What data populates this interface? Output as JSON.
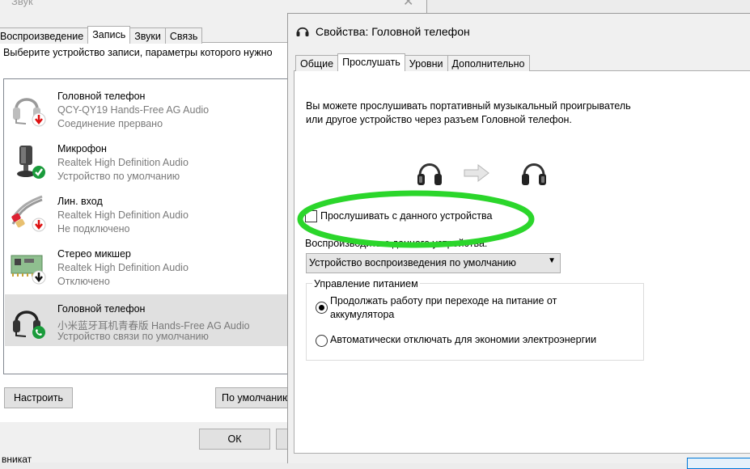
{
  "sound_window": {
    "title": "Звук",
    "close_glyph": "✕",
    "tabs": [
      {
        "label": "Воспроизведение"
      },
      {
        "label": "Запись"
      },
      {
        "label": "Звуки"
      },
      {
        "label": "Связь"
      }
    ],
    "instruction": "Выберите устройство записи, параметры которого нужно",
    "devices": [
      {
        "name": "Головной телефон",
        "driver": "QCY-QY19 Hands-Free AG Audio",
        "status": "Соединение прервано",
        "icon": "headset-icon",
        "badge": "red-down-arrow-badge"
      },
      {
        "name": "Микрофон",
        "driver": "Realtek High Definition Audio",
        "status": "Устройство по умолчанию",
        "icon": "microphone-icon",
        "badge": "green-check-badge"
      },
      {
        "name": "Лин. вход",
        "driver": "Realtek High Definition Audio",
        "status": "Не подключено",
        "icon": "rca-cable-icon",
        "badge": "red-down-arrow-badge"
      },
      {
        "name": "Стерео микшер",
        "driver": "Realtek High Definition Audio",
        "status": "Отключено",
        "icon": "sound-card-icon",
        "badge": "black-down-arrow-badge"
      },
      {
        "name": "Головной телефон",
        "driver": "小米蓝牙耳机青春版 Hands-Free AG Audio",
        "status": "Устройство связи по умолчанию",
        "icon": "headset-icon",
        "badge": "green-phone-badge"
      }
    ],
    "buttons": {
      "configure": "Настроить",
      "set_default": "По умолчанию",
      "ok": "ОК"
    },
    "bottom_text": "вникат"
  },
  "props_dialog": {
    "title": "Свойства: Головной телефон",
    "tabs": [
      {
        "label": "Общие"
      },
      {
        "label": "Прослушать"
      },
      {
        "label": "Уровни"
      },
      {
        "label": "Дополнительно"
      }
    ],
    "description": "Вы можете прослушивать портативный музыкальный проигрыватель или другое устройство через разъем Головной телефон.",
    "listen_checkbox_label": "Прослушивать с данного устройства",
    "listen_checked": false,
    "playback_via_label": "Воспроизводить с данного устройства:",
    "playback_device": "Устройство воспроизведения по умолчанию",
    "power_group_label": "Управление питанием",
    "power_options": [
      {
        "label": "Продолжать работу при переходе на питание от аккумулятора",
        "selected": true
      },
      {
        "label": "Автоматически отключать для экономии электроэнергии",
        "selected": false
      }
    ]
  },
  "colors": {
    "highlight_ellipse": "#2bd62b",
    "selected_row": "#e0e0e0",
    "accent": "#0078d7"
  }
}
